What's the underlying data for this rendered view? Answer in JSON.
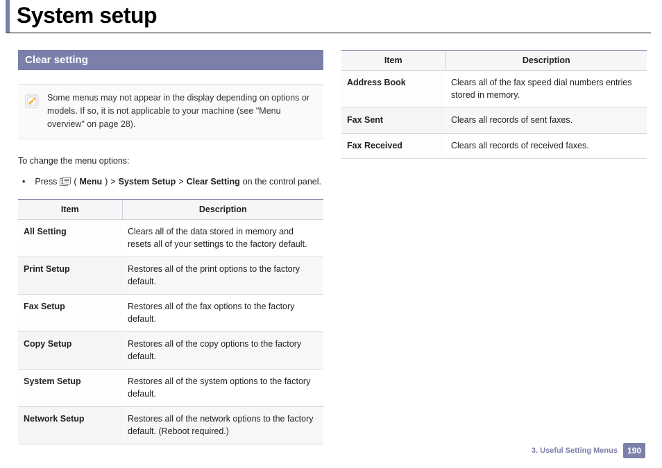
{
  "page_title": "System setup",
  "section_heading": "Clear setting",
  "note": "Some menus may not appear in the display depending on options or models. If so, it is not applicable to your machine (see \"Menu overview\" on page 28).",
  "intro_line": "To change the menu options:",
  "instruction": {
    "prefix": "Press",
    "open_paren": "(",
    "menu": "Menu",
    "close_paren": ")",
    "sep": ">",
    "s1": "System Setup",
    "s2": "Clear Setting",
    "suffix": "on the control panel."
  },
  "table_headers": {
    "item": "Item",
    "desc": "Description"
  },
  "left_table": [
    {
      "item": "All Setting",
      "desc": "Clears all of the data stored in memory and resets all of your settings to the factory default."
    },
    {
      "item": "Print Setup",
      "desc": "Restores all of the print options to the factory default."
    },
    {
      "item": "Fax Setup",
      "desc": "Restores all of the fax options to the factory default."
    },
    {
      "item": "Copy Setup",
      "desc": "Restores all of the copy options to the factory default."
    },
    {
      "item": "System Setup",
      "desc": "Restores all of the system options to the factory default."
    },
    {
      "item": "Network Setup",
      "desc": "Restores all of the network options to the factory default. (Reboot required.)"
    }
  ],
  "right_table": [
    {
      "item": "Address Book",
      "desc": "Clears all of the fax speed dial numbers entries stored in memory."
    },
    {
      "item": "Fax Sent",
      "desc": "Clears all records of sent faxes."
    },
    {
      "item": "Fax Received",
      "desc": "Clears all records of received faxes."
    }
  ],
  "footer": {
    "chapter": "3.  Useful Setting Menus",
    "page": "190"
  }
}
